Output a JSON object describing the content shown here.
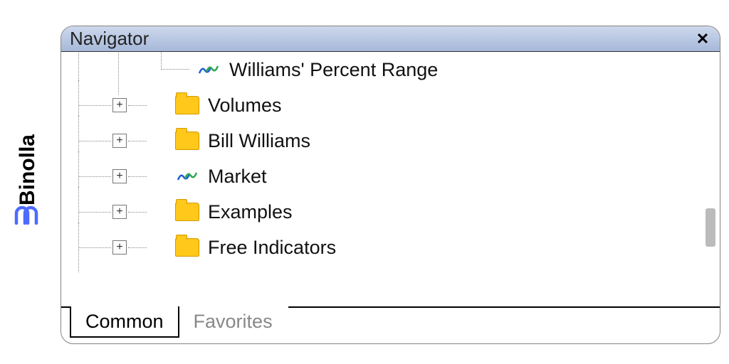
{
  "brand": {
    "name": "Binolla"
  },
  "panel": {
    "title": "Navigator",
    "tree": {
      "leaf": {
        "label": "Williams' Percent Range",
        "icon": "indicator"
      },
      "items": [
        {
          "label": "Volumes",
          "icon": "folder",
          "expandable": true
        },
        {
          "label": "Bill Williams",
          "icon": "folder",
          "expandable": true
        },
        {
          "label": "Market",
          "icon": "indicator",
          "expandable": true
        },
        {
          "label": "Examples",
          "icon": "folder",
          "expandable": true
        },
        {
          "label": "Free Indicators",
          "icon": "folder",
          "expandable": true
        }
      ]
    },
    "tabs": {
      "active": "Common",
      "items": [
        {
          "label": "Common",
          "active": true
        },
        {
          "label": "Favorites",
          "active": false
        }
      ]
    }
  }
}
